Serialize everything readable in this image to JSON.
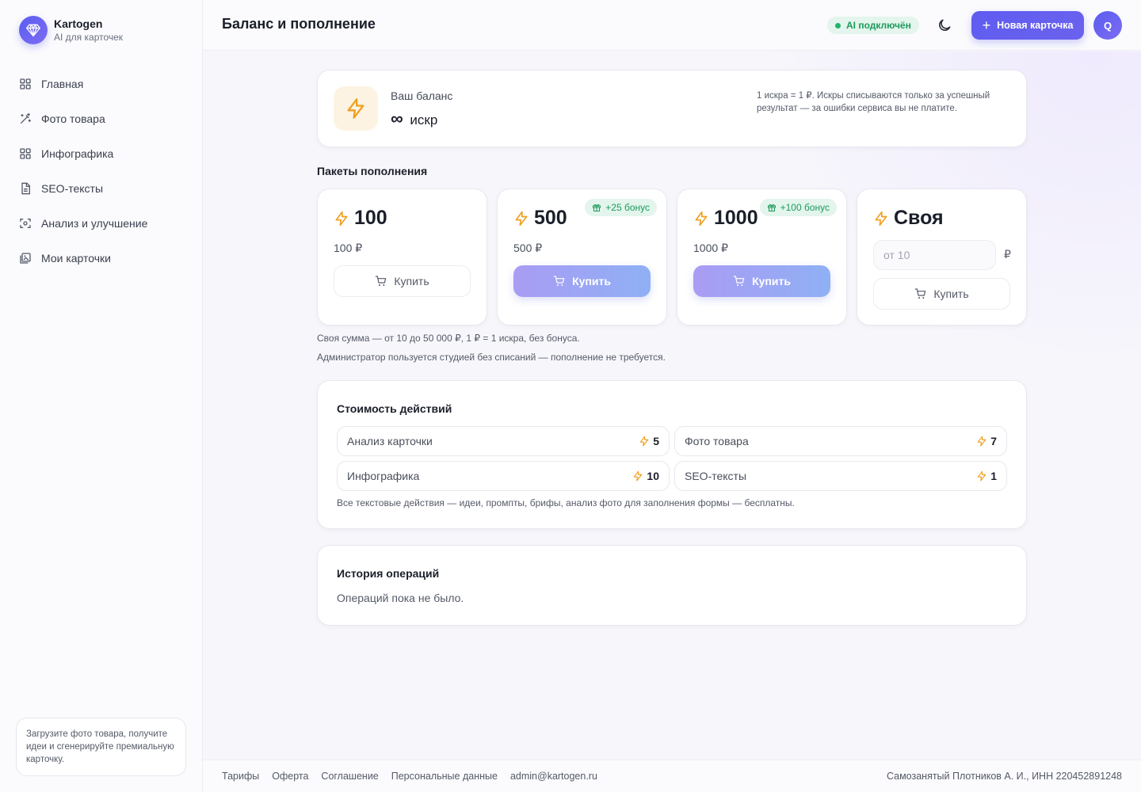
{
  "brand": {
    "name": "Kartogen",
    "subtitle": "AI для карточек"
  },
  "sidebar": {
    "items": [
      {
        "label": "Главная",
        "icon": "grid-icon"
      },
      {
        "label": "Фото товара",
        "icon": "magic-wand-icon"
      },
      {
        "label": "Инфографика",
        "icon": "grid-icon"
      },
      {
        "label": "SEO-тексты",
        "icon": "document-icon"
      },
      {
        "label": "Анализ и улучшение",
        "icon": "scan-icon"
      },
      {
        "label": "Мои карточки",
        "icon": "gallery-icon"
      }
    ],
    "tip": "Загрузите фото товара, получите идеи и сгенерируйте премиальную карточку."
  },
  "header": {
    "title": "Баланс и пополнение",
    "ai_status": "AI подключён",
    "new_card_label": "Новая карточка",
    "avatar_letter": "Q"
  },
  "balance": {
    "label": "Ваш баланс",
    "value": "∞",
    "unit": "искр",
    "note": "1 искра = 1 ₽. Искры списываются только за успешный результат — за ошибки сервиса вы не платите."
  },
  "packages": {
    "title": "Пакеты пополнения",
    "items": [
      {
        "amount": "100",
        "price": "100 ₽",
        "bonus": "",
        "buy_label": "Купить"
      },
      {
        "amount": "500",
        "price": "500 ₽",
        "bonus": "+25 бонус",
        "buy_label": "Купить"
      },
      {
        "amount": "1000",
        "price": "1000 ₽",
        "bonus": "+100 бонус",
        "buy_label": "Купить"
      }
    ],
    "custom": {
      "amount": "Своя",
      "placeholder": "от 10",
      "currency": "₽",
      "buy_label": "Купить"
    },
    "hint1": "Своя сумма — от 10 до 50 000 ₽, 1 ₽ = 1 искра, без бонуса.",
    "hint2": "Администратор пользуется студией без списаний — пополнение не требуется."
  },
  "costs": {
    "title": "Стоимость действий",
    "items": [
      {
        "name": "Анализ карточки",
        "value": "5"
      },
      {
        "name": "Фото товара",
        "value": "7"
      },
      {
        "name": "Инфографика",
        "value": "10"
      },
      {
        "name": "SEO-тексты",
        "value": "1"
      }
    ],
    "note": "Все текстовые действия — идеи, промпты, брифы, анализ фото для заполнения формы — бесплатны."
  },
  "history": {
    "title": "История операций",
    "empty": "Операций пока не было."
  },
  "footer": {
    "links": [
      "Тарифы",
      "Оферта",
      "Соглашение",
      "Персональные данные",
      "admin@kartogen.ru"
    ],
    "right": "Самозанятый Плотников А. И., ИНН 220452891248"
  },
  "colors": {
    "accent": "#5f5cf0",
    "bolt": "#f0a020",
    "success": "#1d9a5d"
  }
}
